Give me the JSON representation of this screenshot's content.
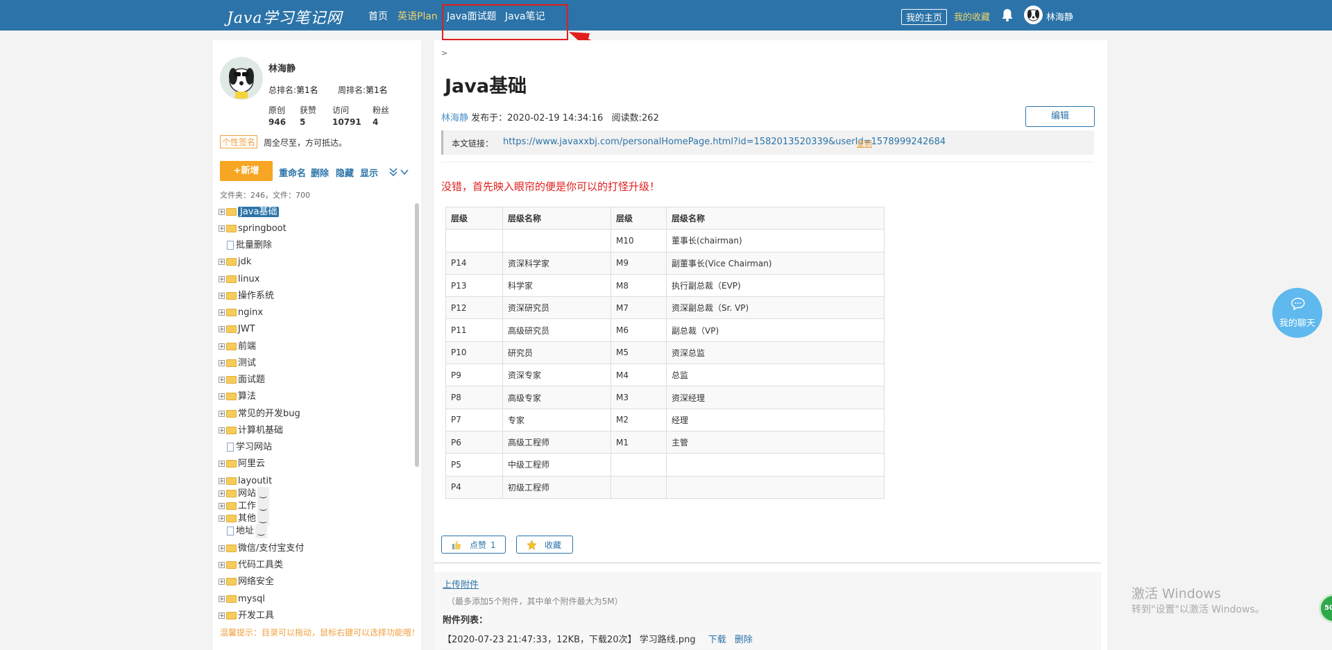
{
  "nav": {
    "logo": "Java学习笔记网",
    "items": [
      "首页",
      "英语Plan",
      "Java面试题",
      "Java笔记"
    ],
    "my_home": "我的主页",
    "my_fav": "我的收藏",
    "user": "林海静"
  },
  "profile": {
    "name": "林海静",
    "rank_total_label": "总排名:",
    "rank_total": "第1名",
    "rank_week_label": "周排名:",
    "rank_week": "第1名",
    "stats": [
      {
        "label": "原创",
        "value": "946"
      },
      {
        "label": "获赞",
        "value": "5"
      },
      {
        "label": "访问",
        "value": "10791"
      },
      {
        "label": "粉丝",
        "value": "4"
      }
    ],
    "sig_tag": "个性签名",
    "signature": "周全尽至，方可抵达。"
  },
  "toolbar": {
    "add": "+新增",
    "rename": "重命名",
    "delete": "删除",
    "hide": "隐藏",
    "show": "显示"
  },
  "counts": "文件夹：246，文件：700",
  "tree": [
    {
      "type": "folder",
      "label": "Java基础",
      "selected": true
    },
    {
      "type": "folder",
      "label": "springboot"
    },
    {
      "type": "file",
      "label": "批量删除"
    },
    {
      "type": "folder",
      "label": "jdk"
    },
    {
      "type": "folder",
      "label": "linux"
    },
    {
      "type": "folder",
      "label": "操作系统"
    },
    {
      "type": "folder",
      "label": "nginx"
    },
    {
      "type": "folder",
      "label": "JWT"
    },
    {
      "type": "folder",
      "label": "前端"
    },
    {
      "type": "folder",
      "label": "测试"
    },
    {
      "type": "folder",
      "label": "面试题"
    },
    {
      "type": "folder",
      "label": "算法"
    },
    {
      "type": "folder",
      "label": "常见的开发bug"
    },
    {
      "type": "folder",
      "label": "计算机基础"
    },
    {
      "type": "file",
      "label": "学习网站"
    },
    {
      "type": "folder",
      "label": "阿里云"
    },
    {
      "type": "folder",
      "label": "layoutit"
    },
    {
      "type": "folder",
      "label": "网站",
      "tilde": true
    },
    {
      "type": "folder",
      "label": "工作",
      "tilde": true
    },
    {
      "type": "folder",
      "label": "其他",
      "tilde": true
    },
    {
      "type": "file",
      "label": "地址",
      "tilde": true
    },
    {
      "type": "folder",
      "label": "微信/支付宝支付"
    },
    {
      "type": "folder",
      "label": "代码工具类"
    },
    {
      "type": "folder",
      "label": "网络安全"
    },
    {
      "type": "folder",
      "label": "mysql"
    },
    {
      "type": "folder",
      "label": "开发工具"
    }
  ],
  "tip": "温馨提示：目录可以拖动，鼠标右键可以选择功能哦！",
  "article": {
    "crumb": ">",
    "title": "Java基础",
    "author": "林海静",
    "published": "发布于：2020-02-19 14:34:16",
    "reads": "阅读数:262",
    "edit": "编辑",
    "link_label": "本文链接：",
    "link_url": "https://www.javaxxbj.com/personalHomePage.html?id=1582013520339&userId=1578999242684",
    "copy": "复制",
    "intro": "没错，首先映入眼帘的便是你可以的打怪升级！",
    "table": [
      [
        "层级",
        "层级名称",
        "层级",
        "层级名称"
      ],
      [
        "",
        "",
        "M10",
        "董事长(chairman)"
      ],
      [
        "P14",
        "资深科学家",
        "M9",
        "副董事长(Vice Chairman)"
      ],
      [
        "P13",
        "科学家",
        "M8",
        "执行副总裁（EVP)"
      ],
      [
        "P12",
        "资深研究员",
        "M7",
        "资深副总裁（Sr. VP)"
      ],
      [
        "P11",
        "高级研究员",
        "M6",
        "副总裁（VP)"
      ],
      [
        "P10",
        "研究员",
        "M5",
        "资深总监"
      ],
      [
        "P9",
        "资深专家",
        "M4",
        "总监"
      ],
      [
        "P8",
        "高级专家",
        "M3",
        "资深经理"
      ],
      [
        "P7",
        "专家",
        "M2",
        "经理"
      ],
      [
        "P6",
        "高级工程师",
        "M1",
        "主管"
      ],
      [
        "P5",
        "中级工程师",
        "",
        ""
      ],
      [
        "P4",
        "初级工程师",
        "",
        ""
      ]
    ],
    "like": "点赞",
    "like_count": "1",
    "fav": "收藏"
  },
  "attachments": {
    "upload": "上传附件",
    "hint": "（最多添加5个附件，其中单个附件最大为5M）",
    "list_label": "附件列表：",
    "item": "【2020-07-23 21:47:33，12KB，下载20次】 学习路线.png",
    "download": "下载",
    "delete": "删除"
  },
  "chat": "我的聊天",
  "watermark": {
    "line1": "激活 Windows",
    "line2": "转到\"设置\"以激活 Windows。"
  },
  "badge": "50",
  "colors": {
    "nav": "#2b73a8",
    "accent": "#f6a623",
    "red": "#e0201d"
  }
}
